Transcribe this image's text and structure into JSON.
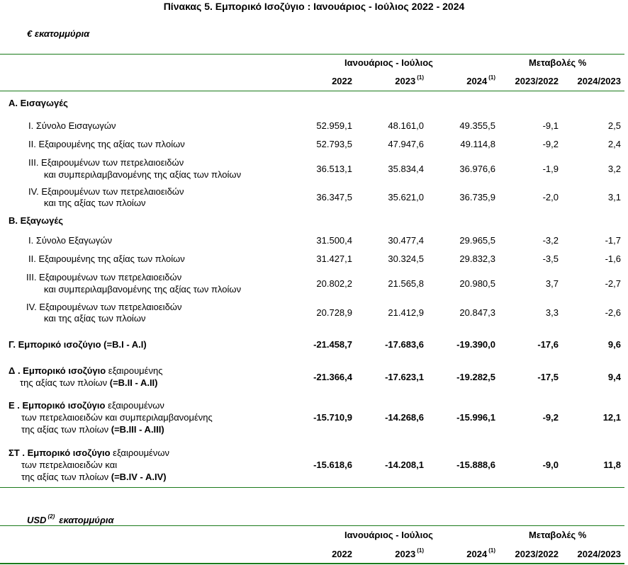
{
  "title": "Πίνακας 5. Εμπορικό Ισοζύγιο : Ιανουάριος - Ιούλιος 2022 - 2024",
  "section1": {
    "unit": "€ εκατομμύρια",
    "header": {
      "group1": "Ιανουάριος - Ιούλιος",
      "group2": "Μεταβολές %",
      "y2022": "2022",
      "y2023": "2023",
      "y2023_note": "(1)",
      "y2024": "2024",
      "y2024_note": "(1)",
      "c1": "2023/2022",
      "c2": "2024/2023"
    },
    "imports_heading": "Α. Εισαγωγές",
    "exports_heading": "Β. Εξαγωγές",
    "rows": [
      {
        "label1": "I.   Σύνολο Εισαγωγών",
        "label2": "",
        "v2022": "52.959,1",
        "v2023": "48.161,0",
        "v2024": "49.355,5",
        "c1": "-9,1",
        "c2": "2,5"
      },
      {
        "label1": "II.   Εξαιρουμένης  της αξίας των πλοίων",
        "label2": "",
        "v2022": "52.793,5",
        "v2023": "47.947,6",
        "v2024": "49.114,8",
        "c1": "-9,2",
        "c2": "2,4"
      },
      {
        "label1": "III.  Εξαιρουμένων των πετρελαιοειδών",
        "label2": "και συμπεριλαμβανομένης της αξίας των πλοίων",
        "v2022": "36.513,1",
        "v2023": "35.834,4",
        "v2024": "36.976,6",
        "c1": "-1,9",
        "c2": "3,2"
      },
      {
        "label1": "IV.  Εξαιρουμένων των πετρελαιοειδών",
        "label2": "και  της αξίας των πλοίων",
        "v2022": "36.347,5",
        "v2023": "35.621,0",
        "v2024": "36.735,9",
        "c1": "-2,0",
        "c2": "3,1"
      },
      {
        "label1": "I.  Σύνολο Εξαγωγών",
        "label2": "",
        "v2022": "31.500,4",
        "v2023": "30.477,4",
        "v2024": "29.965,5",
        "c1": "-3,2",
        "c2": "-1,7"
      },
      {
        "label1": "II.  Εξαιρουμένης  της αξίας των πλοίων",
        "label2": "",
        "v2022": "31.427,1",
        "v2023": "30.324,5",
        "v2024": "29.832,3",
        "c1": "-3,5",
        "c2": "-1,6"
      },
      {
        "label1": "III.  Εξαιρουμένων των πετρελαιοειδών",
        "label2": "και συμπεριλαμβανομένης  της αξίας των πλοίων",
        "v2022": "20.802,2",
        "v2023": "21.565,8",
        "v2024": "20.980,5",
        "c1": "3,7",
        "c2": "-2,7"
      },
      {
        "label1": "IV.  Εξαιρουμένων των πετρελαιοειδών",
        "label2": "και  της αξίας των πλοίων",
        "v2022": "20.728,9",
        "v2023": "21.412,9",
        "v2024": "20.847,3",
        "c1": "3,3",
        "c2": "-2,6"
      }
    ],
    "balances": [
      {
        "l1b": "Γ. Εμπορικό ισοζύγιο (=B.I - A.I)",
        "l1": "",
        "l2": "",
        "l2b": "",
        "l3": "",
        "l3b": "",
        "v2022": "-21.458,7",
        "v2023": "-17.683,6",
        "v2024": "-19.390,0",
        "c1": "-17,6",
        "c2": "9,6"
      },
      {
        "l1b": "Δ . Εμπορικό ισοζύγιο",
        "l1": " εξαιρουμένης",
        "l2": "της αξίας των πλοίων ",
        "l2b": "(=B.II - A.II)",
        "l3": "",
        "l3b": "",
        "v2022": "-21.366,4",
        "v2023": "-17.623,1",
        "v2024": "-19.282,5",
        "c1": "-17,5",
        "c2": "9,4"
      },
      {
        "l1b": "Ε . Εμπορικό ισοζύγιο",
        "l1": " εξαιρουμένων",
        "l2": "των πετρελαιοειδών και συμπεριλαμβανομένης",
        "l2b": "",
        "l3": "της αξίας των πλοίων ",
        "l3b": "(=B.III - A.III)",
        "v2022": "-15.710,9",
        "v2023": "-14.268,6",
        "v2024": "-15.996,1",
        "c1": "-9,2",
        "c2": "12,1"
      },
      {
        "l1b": "ΣΤ . Εμπορικό ισοζύγιο",
        "l1": " εξαιρουμένων",
        "l2": "των πετρελαιοειδών και",
        "l2b": "",
        "l3": "της αξίας των πλοίων ",
        "l3b": "(=B.IV - A.IV)",
        "v2022": "-15.618,6",
        "v2023": "-14.208,1",
        "v2024": "-15.888,6",
        "c1": "-9,0",
        "c2": "11,8"
      }
    ]
  },
  "section2": {
    "unit_a": "USD",
    "unit_note": "(2)",
    "unit_b": "εκατομμύρια",
    "header": {
      "group1": "Ιανουάριος - Ιούλιος",
      "group2": "Μεταβολές %",
      "y2022": "2022",
      "y2023": "2023",
      "y2023_note": "(1)",
      "y2024": "2024",
      "y2024_note": "(1)",
      "c1": "2023/2022",
      "c2": "2024/2023"
    }
  },
  "colors": {
    "rule": "#1a7a1a"
  }
}
